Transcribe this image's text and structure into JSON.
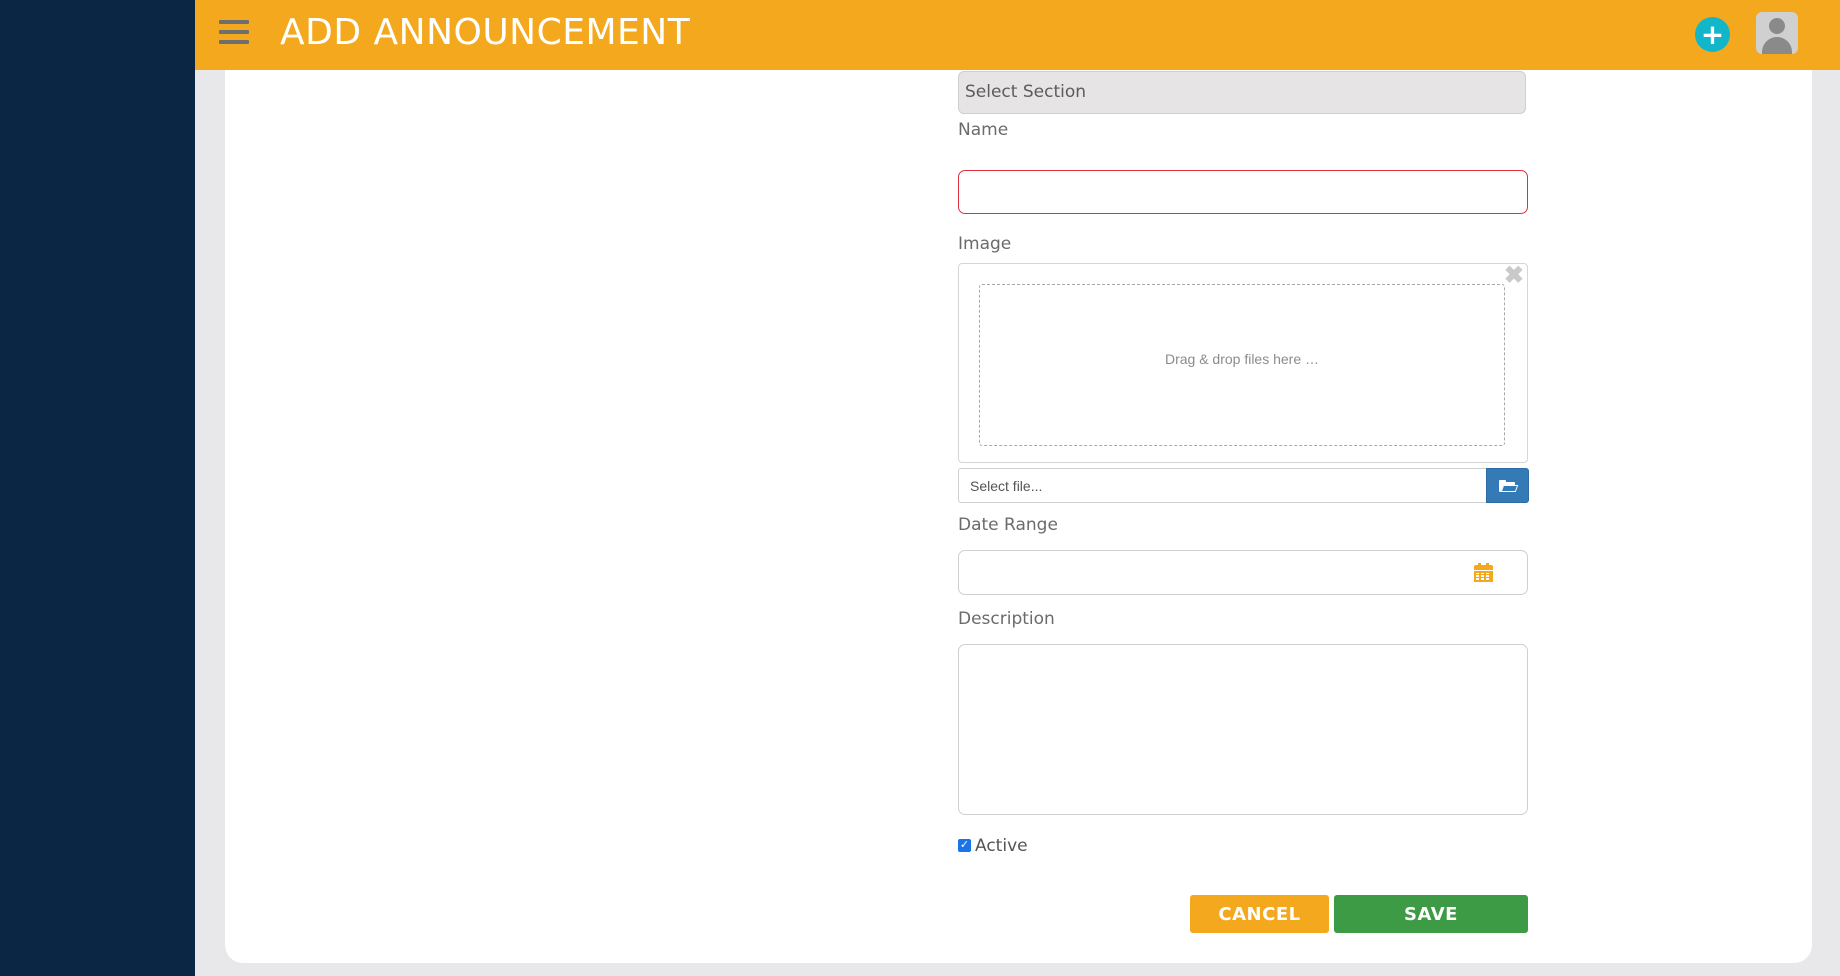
{
  "header": {
    "title": "ADD ANNOUNCEMENT",
    "add_icon": "plus-circle-icon",
    "avatar_icon": "user-avatar-icon"
  },
  "form": {
    "section_select": {
      "selected": "Select Section"
    },
    "name": {
      "label": "Name",
      "value": ""
    },
    "image": {
      "label": "Image",
      "dropzone_text": "Drag & drop files here …",
      "file_placeholder": "Select file...",
      "close_icon": "close-icon",
      "browse_icon": "folder-open-icon"
    },
    "date_range": {
      "label": "Date Range",
      "value": "",
      "icon": "calendar-icon"
    },
    "description": {
      "label": "Description",
      "value": ""
    },
    "active": {
      "label": "Active",
      "checked": true
    },
    "buttons": {
      "cancel": "CANCEL",
      "save": "SAVE"
    }
  },
  "colors": {
    "sidebar": "#0b2545",
    "header": "#f4a81d",
    "add_button": "#13b5c8",
    "error_border": "#e0323c",
    "browse_button": "#337ab7",
    "save_button": "#3d9a45",
    "cancel_button": "#f4a81d"
  }
}
